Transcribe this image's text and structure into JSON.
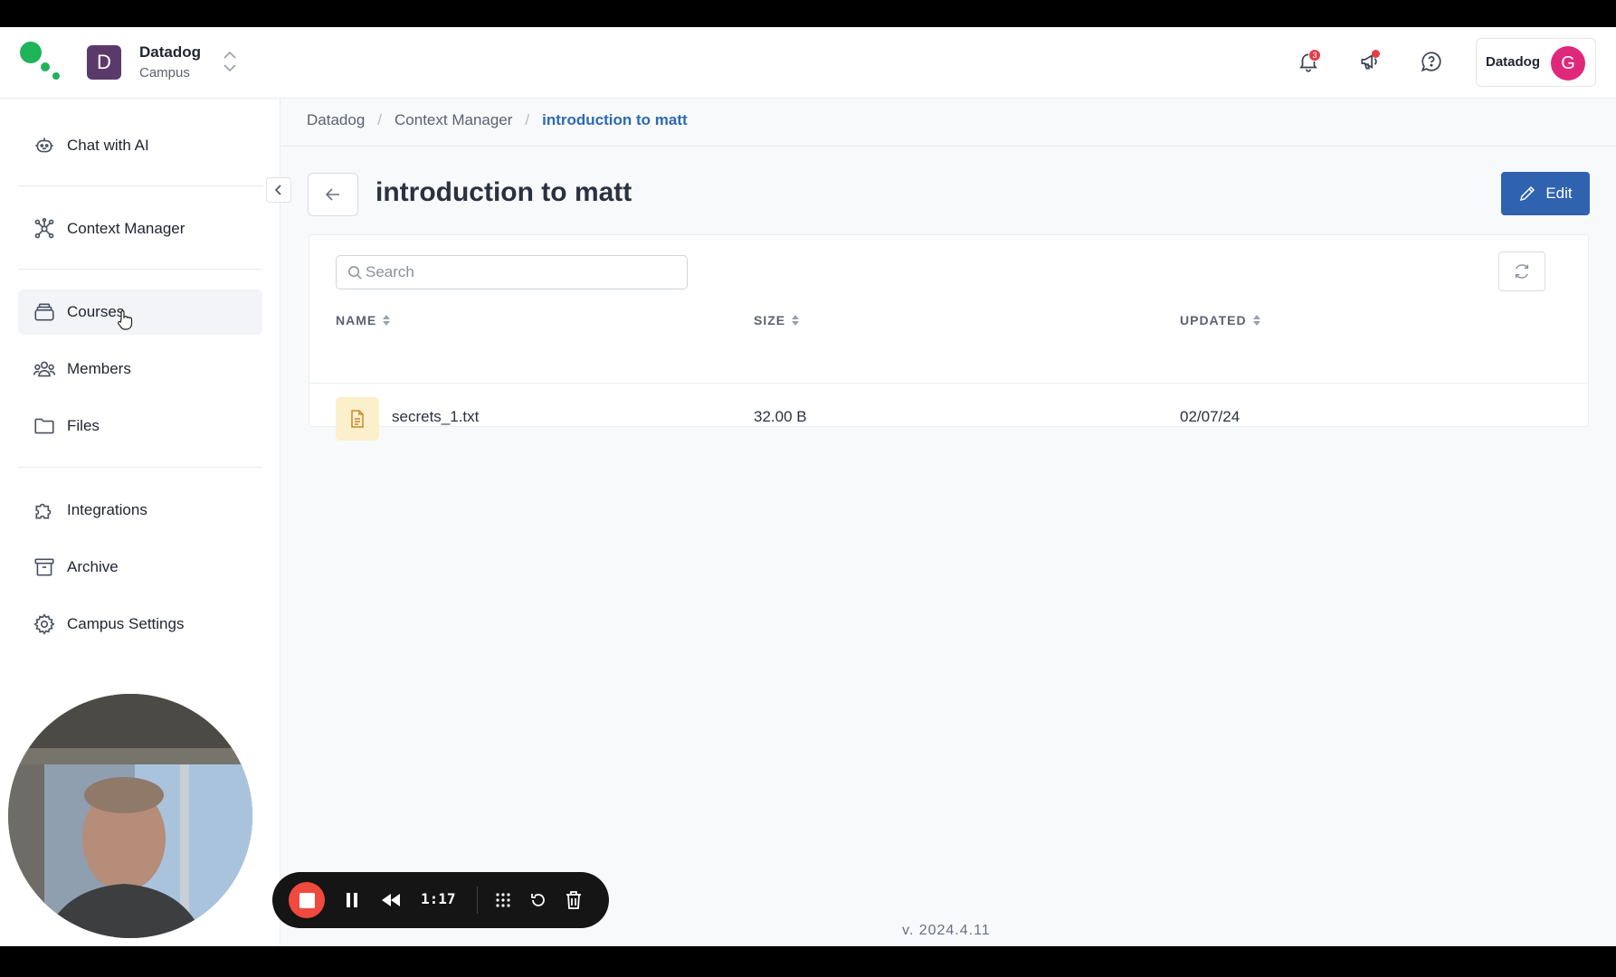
{
  "org": {
    "initial": "D",
    "name": "Datadog",
    "subtitle": "Campus"
  },
  "header": {
    "notifications_count": "3",
    "user_label": "Datadog",
    "avatar_initial": "G"
  },
  "sidebar": {
    "items": [
      {
        "label": "Chat with AI",
        "icon": "robot-icon"
      },
      {
        "label": "Context Manager",
        "icon": "network-icon"
      },
      {
        "label": "Courses",
        "icon": "stack-icon"
      },
      {
        "label": "Members",
        "icon": "people-icon"
      },
      {
        "label": "Files",
        "icon": "folder-icon"
      },
      {
        "label": "Integrations",
        "icon": "puzzle-icon"
      },
      {
        "label": "Archive",
        "icon": "archive-icon"
      },
      {
        "label": "Campus Settings",
        "icon": "gear-icon"
      }
    ]
  },
  "breadcrumb": [
    "Datadog",
    "Context Manager",
    "introduction to matt"
  ],
  "page": {
    "title": "introduction to matt",
    "edit_label": "Edit"
  },
  "search": {
    "placeholder": "Search",
    "value": ""
  },
  "table": {
    "columns": [
      "NAME",
      "SIZE",
      "UPDATED"
    ],
    "rows": [
      {
        "name": "secrets_1.txt",
        "size": "32.00 B",
        "updated": "02/07/24"
      }
    ]
  },
  "footer": {
    "version": "v. 2024.4.11"
  },
  "recorder": {
    "time": "1:17"
  },
  "colors": {
    "primary": "#2f63b0",
    "breadcrumb_active": "#2d6ab3",
    "org_badge": "#5b3a6b",
    "avatar": "#e0287a",
    "logo_green": "#1fb35a",
    "record_red": "#f0493e"
  }
}
